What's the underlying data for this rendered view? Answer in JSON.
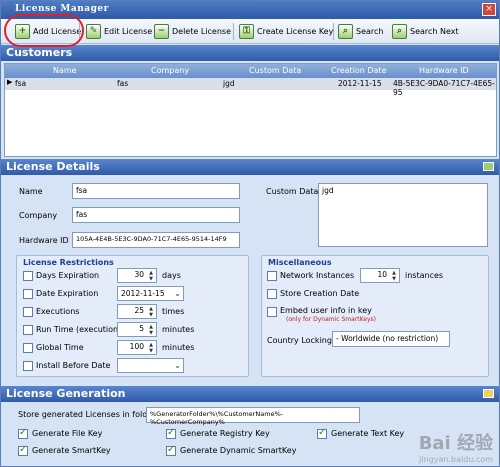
{
  "window": {
    "title": "License Manager",
    "close_glyph": "×"
  },
  "toolbar": {
    "add": "Add License",
    "edit": "Edit License",
    "delete": "Delete License",
    "create_key": "Create License Key",
    "search": "Search",
    "search_next": "Search Next"
  },
  "customers": {
    "title": "Customers",
    "columns": [
      "Name",
      "Company",
      "Custom Data",
      "Creation Date",
      "Hardware ID"
    ],
    "rows": [
      {
        "name": "fsa",
        "company": "fas",
        "custom_data": "jgd",
        "creation_date": "2012-11-15",
        "hardware_id": "4B-5E3C-9DA0-71C7-4E65-95"
      }
    ],
    "row_indicator": "▶"
  },
  "details": {
    "title": "License Details",
    "name_label": "Name",
    "name_value": "fsa",
    "company_label": "Company",
    "company_value": "fas",
    "hwid_label": "Hardware ID",
    "hwid_value": "105A-4E4B-5E3C-9DA0-71C7-4E65-9514-14F9",
    "custom_label": "Custom Data",
    "custom_value": "jgd"
  },
  "restrictions": {
    "title": "License Restrictions",
    "days_label": "Days Expiration",
    "days_value": "30",
    "days_unit": "days",
    "date_label": "Date Expiration",
    "date_value": "2012-11-15",
    "exec_label": "Executions",
    "exec_value": "25",
    "exec_unit": "times",
    "runtime_label": "Run Time (execution)",
    "runtime_value": "5",
    "runtime_unit": "minutes",
    "global_label": "Global Time",
    "global_value": "100",
    "global_unit": "minutes",
    "before_label": "Install Before Date",
    "before_value": ""
  },
  "misc": {
    "title": "Miscellaneous",
    "network_label": "Network Instances",
    "network_value": "10",
    "network_unit": "instances",
    "store_label": "Store Creation Date",
    "embed_label": "Embed user info in key",
    "embed_note": "(only for Dynamic SmartKeys)",
    "country_label": "Country Locking",
    "country_value": "- Worldwide (no restriction)"
  },
  "generation": {
    "title": "License Generation",
    "folder_label": "Store generated Licenses in folder:",
    "folder_value": "%GeneratorFolder%\\%CustomerName%-%CustomerCompany%",
    "file_key": "Generate File Key",
    "registry_key": "Generate Registry Key",
    "text_key": "Generate Text Key",
    "smartkey": "Generate SmartKey",
    "dynamic_smartkey": "Generate Dynamic SmartKey"
  },
  "watermark": {
    "text": "Bai  经验",
    "url": "jingyan.baidu.com"
  },
  "colors": {
    "title_bar": "#2f5aa5",
    "accent_red_circle": "#e0202a",
    "panel": "#d6e3f5"
  }
}
